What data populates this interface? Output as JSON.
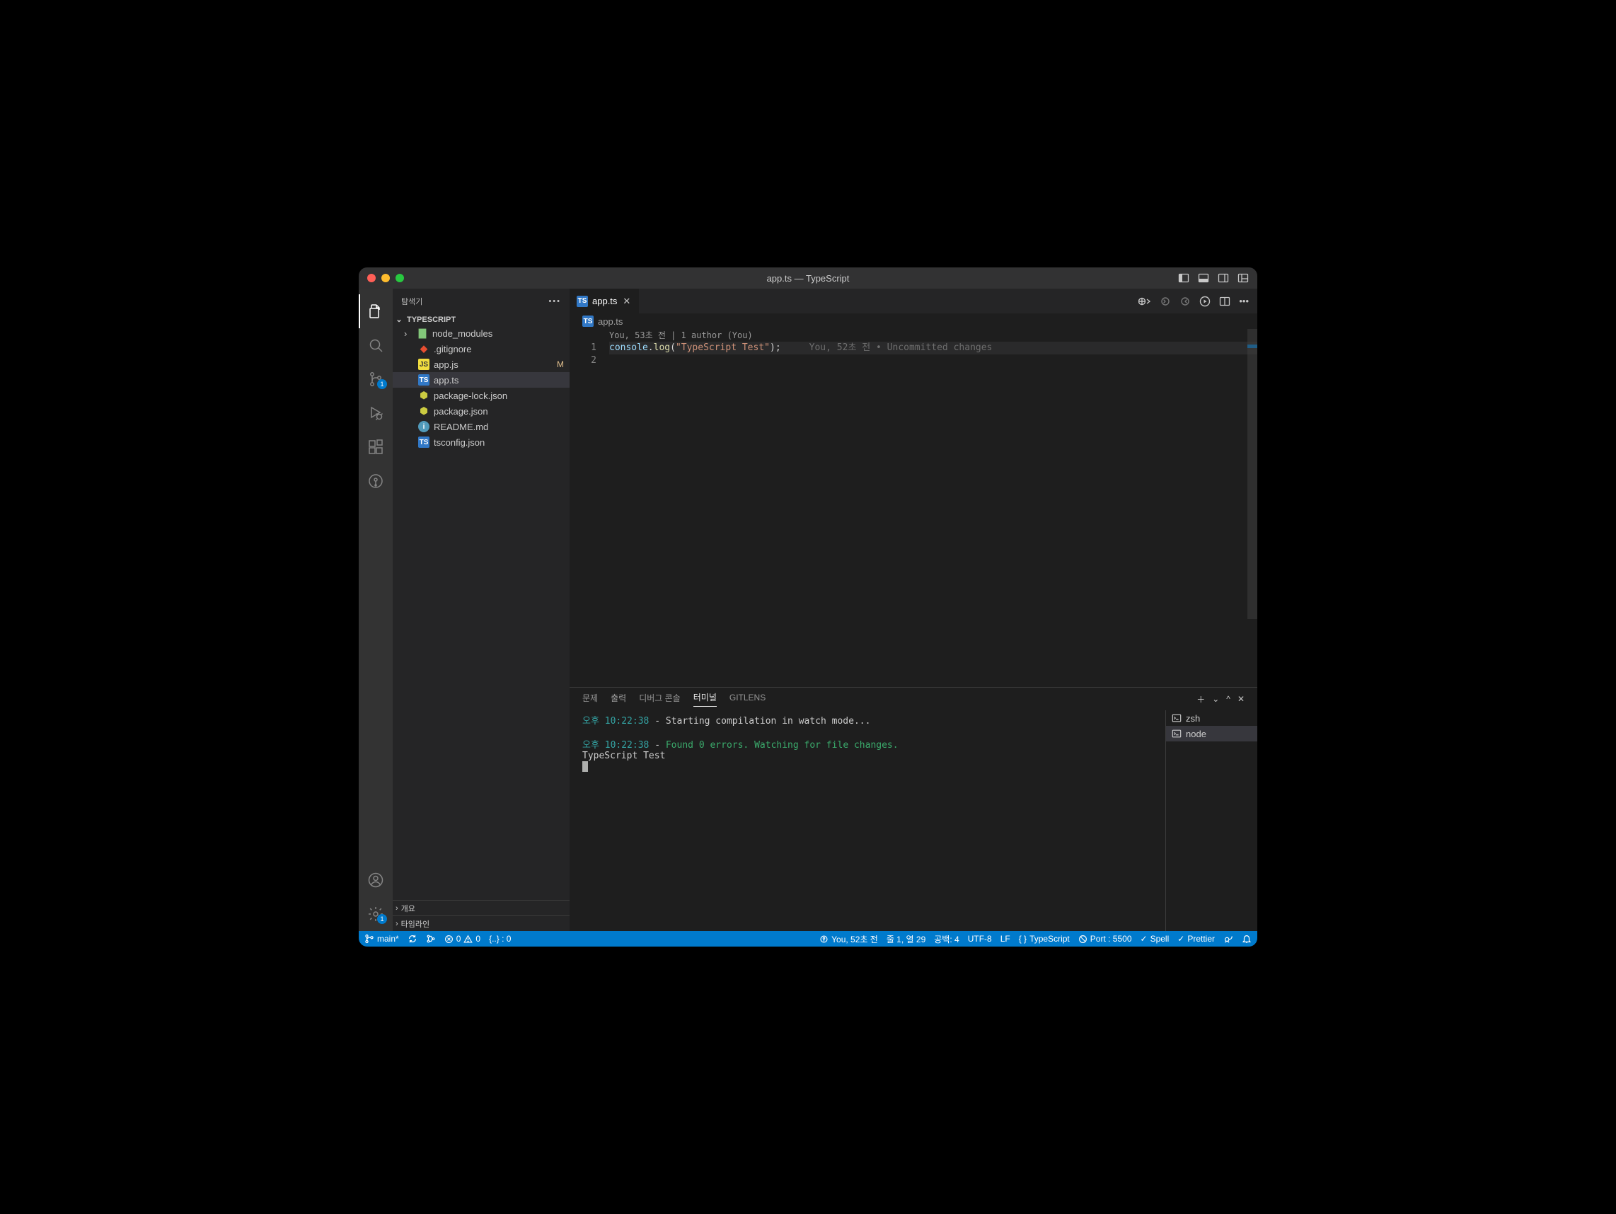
{
  "window_title": "app.ts — TypeScript",
  "sidebar": {
    "title": "탐색기",
    "section": "TYPESCRIPT",
    "items": [
      {
        "name": "node_modules",
        "kind": "folder",
        "expandable": true
      },
      {
        "name": ".gitignore",
        "kind": "git"
      },
      {
        "name": "app.js",
        "kind": "js",
        "status": "M"
      },
      {
        "name": "app.ts",
        "kind": "ts",
        "selected": true
      },
      {
        "name": "package-lock.json",
        "kind": "json"
      },
      {
        "name": "package.json",
        "kind": "json"
      },
      {
        "name": "README.md",
        "kind": "md"
      },
      {
        "name": "tsconfig.json",
        "kind": "tsjson"
      }
    ],
    "collapsed": [
      {
        "label": "개요"
      },
      {
        "label": "타임라인"
      }
    ]
  },
  "activity_badge_scm": "1",
  "activity_badge_settings": "1",
  "tab": {
    "label": "app.ts"
  },
  "breadcrumb": {
    "label": "app.ts"
  },
  "codelens": "You, 53초 전 | 1 author (You)",
  "code": {
    "lines": [
      "1",
      "2"
    ],
    "tokens": {
      "obj": "console",
      "dot": ".",
      "fn": "log",
      "open": "(",
      "str": "\"TypeScript Test\"",
      "close": ")",
      "semi": ";"
    },
    "blame": "You, 52초 전 • Uncommitted changes"
  },
  "panel": {
    "tabs": [
      "문제",
      "출력",
      "디버그 콘솔",
      "터미널",
      "GITLENS"
    ],
    "active": "터미널",
    "terminals": [
      {
        "name": "zsh"
      },
      {
        "name": "node",
        "active": true
      }
    ],
    "lines": {
      "ts1_a": "오후 10:22:38",
      "ts1_b": " - Starting compilation in watch mode...",
      "ts2_a": "오후 10:22:38",
      "ts2_b": " - ",
      "ts2_c": "Found 0 errors. Watching for file changes.",
      "out": "TypeScript Test"
    }
  },
  "status": {
    "branch": "main*",
    "errors": "0",
    "warnings": "0",
    "json": "{..} : 0",
    "blame": "You, 52초 전",
    "cursor": "줄 1, 열 29",
    "spaces": "공백: 4",
    "encoding": "UTF-8",
    "eol": "LF",
    "lang": "TypeScript",
    "port": "Port : 5500",
    "spell": "Spell",
    "prettier": "Prettier"
  }
}
